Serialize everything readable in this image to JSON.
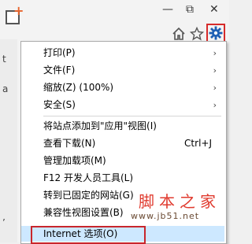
{
  "window": {
    "restore_glyph": "⧉",
    "close_glyph": "✕"
  },
  "left_chars": [
    "t",
    "a",
    "’"
  ],
  "toolbar": {
    "icons": [
      "home-icon",
      "star-icon",
      "gear-icon"
    ]
  },
  "menu": {
    "items": [
      {
        "label": "打印(P)",
        "submenu": true
      },
      {
        "label": "文件(F)",
        "submenu": true
      },
      {
        "label": "缩放(Z) (100%)",
        "submenu": true
      },
      {
        "label": "安全(S)",
        "submenu": true
      },
      {
        "label": "将站点添加到\"应用\"视图(I)",
        "submenu": false
      },
      {
        "label": "查看下载(N)",
        "shortcut": "Ctrl+J",
        "submenu": false
      },
      {
        "label": "管理加载项(M)",
        "submenu": false
      },
      {
        "label": "F12 开发人员工具(L)",
        "submenu": false
      },
      {
        "label": "转到已固定的网站(G)",
        "submenu": false
      },
      {
        "label": "兼容性视图设置(B)",
        "submenu": false
      },
      {
        "label": "Internet 选项(O)",
        "submenu": false,
        "highlighted": true
      }
    ]
  },
  "watermark": {
    "title": "脚本之家",
    "url": "www.jb51.net"
  },
  "colors": {
    "highlight_border": "#c8262c",
    "highlight_bg": "#cde8ff",
    "gear_blue": "#1e5fb4",
    "watermark_red": "#e03a2e"
  }
}
